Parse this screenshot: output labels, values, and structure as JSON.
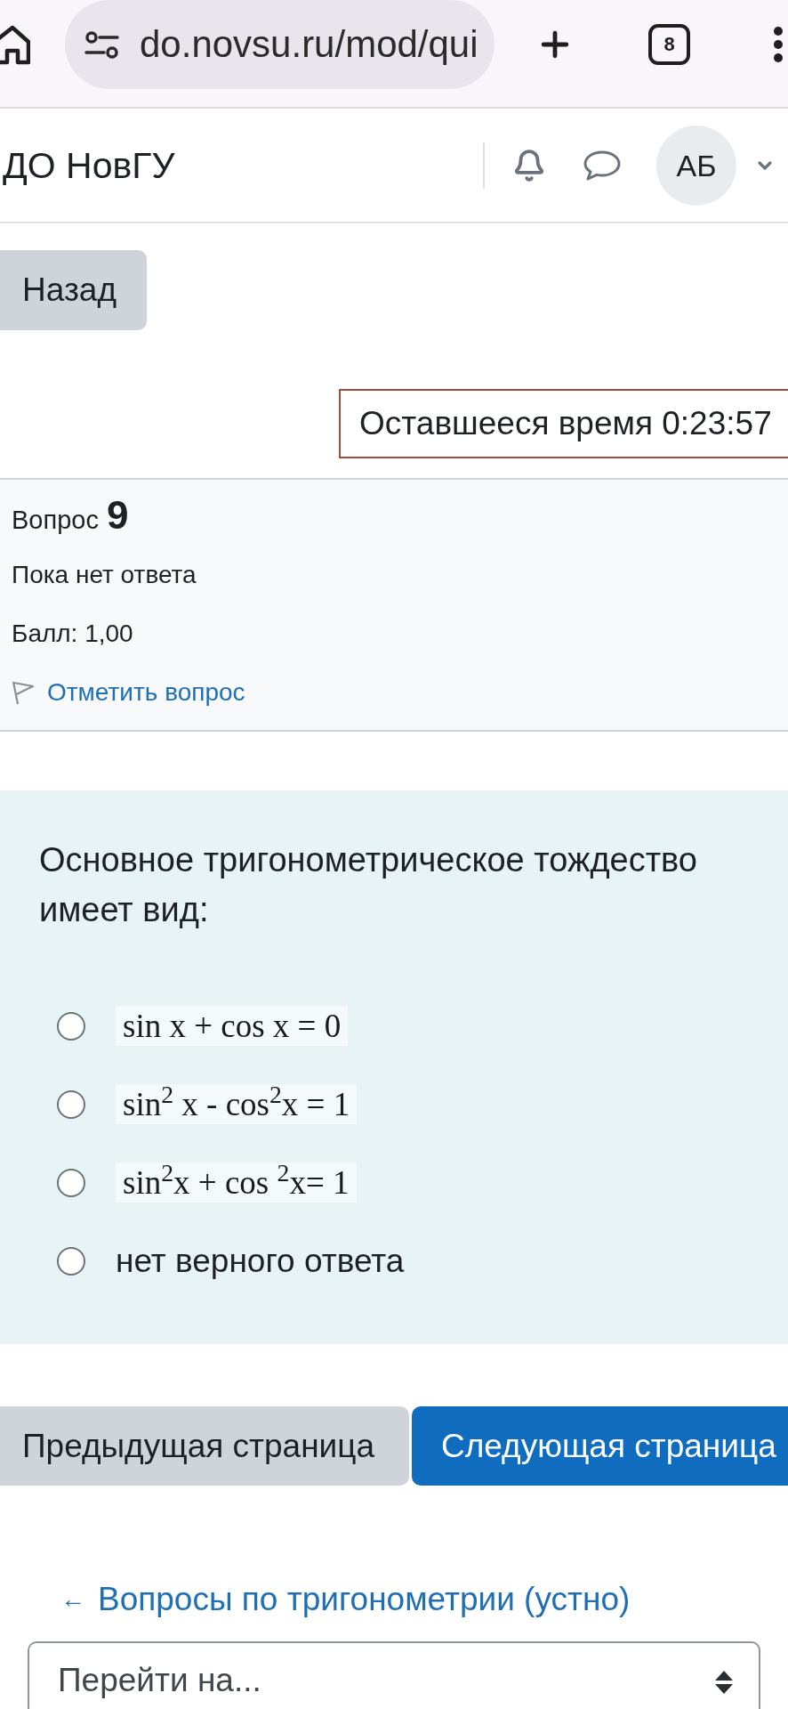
{
  "browser": {
    "url": "do.novsu.ru/mod/qui",
    "tab_count": "8"
  },
  "header": {
    "site_name": "ДО НовГУ",
    "avatar_initials": "АБ"
  },
  "back_button": "Назад",
  "timer": "Оставшееся время 0:23:57",
  "question_info": {
    "label": "Вопрос",
    "number": "9",
    "status": "Пока нет ответа",
    "mark": "Балл: 1,00",
    "flag_link": "Отметить вопрос"
  },
  "question": {
    "text": "Основное тригонометрическое тождество имеет вид:",
    "options": [
      {
        "kind": "formula",
        "label": "sin x + cos x = 0",
        "selected": false
      },
      {
        "kind": "formula",
        "label": "sin$^{2}$ x - cos$^{2}$x = 1",
        "selected": false
      },
      {
        "kind": "formula",
        "label": "sin$^{2}$x + cos $^{2}$x= 1",
        "selected": false
      },
      {
        "kind": "text",
        "label": "нет верного ответа",
        "selected": false
      }
    ]
  },
  "navigation": {
    "previous": "Предыдущая страница",
    "next": "Следующая страница"
  },
  "quiz_link": {
    "arrow": "←",
    "label": "Вопросы по тригонометрии (устно)"
  },
  "jump_select": {
    "value": "Перейти на..."
  }
}
